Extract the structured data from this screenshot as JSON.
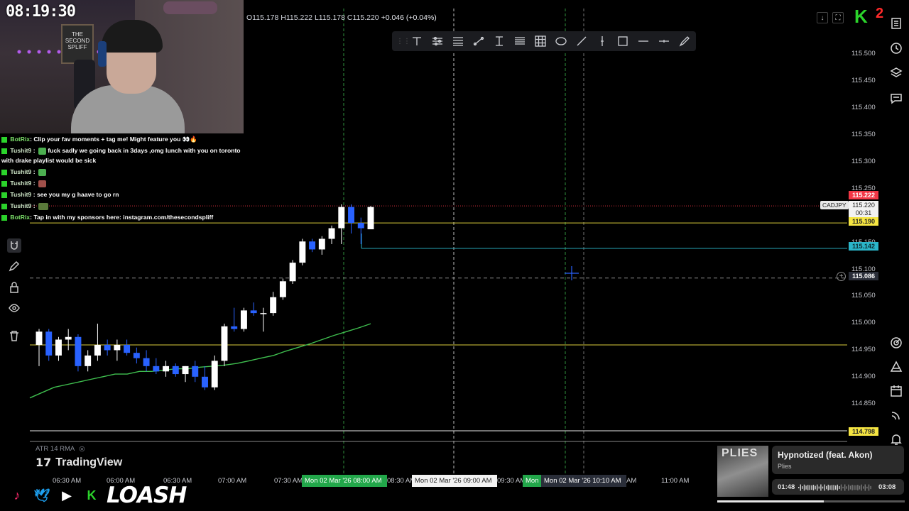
{
  "stream": {
    "clock": "08:19:30",
    "poster_text": "THE SECOND SPLIFF",
    "sign_text": "",
    "kick_count": "2",
    "streamer_name": "LOASH"
  },
  "chat": [
    {
      "user": "BotRix",
      "bot": true,
      "text": "Clip your fav moments + tag me! Might feature you 👀🔥"
    },
    {
      "user": "Tushit9",
      "bot": false,
      "text": "fuck sadly we going back in 3days ,omg lunch with you on toronto with drake playlist would be sick"
    },
    {
      "user": "Tushit9",
      "bot": false,
      "text": ""
    },
    {
      "user": "Tushit9",
      "bot": false,
      "text": ""
    },
    {
      "user": "Tushit9",
      "bot": false,
      "text": "see you my g haave to go rn"
    },
    {
      "user": "Tushit9",
      "bot": false,
      "text": ""
    },
    {
      "user": "BotRix",
      "bot": true,
      "text": "Tap in with my sponsors here: instagram.com/thesecondspliff"
    }
  ],
  "header": {
    "open": "O115.178",
    "high": "H115.222",
    "low": "L115.178",
    "close": "C115.220",
    "change": "+0.046 (+0.04%)"
  },
  "drawing_tools": [
    "text-tool",
    "filters-tool",
    "levels-tool",
    "line-tool",
    "text-cursor-tool",
    "list-tool",
    "grid-tool",
    "shape-tool",
    "diagonal-line-tool",
    "vertical-line-tool",
    "rectangle-tool",
    "horizontal-line-tool",
    "horizontal-ray-tool",
    "brush-tool"
  ],
  "price_axis": {
    "labels": [
      "115.500",
      "115.450",
      "115.400",
      "115.350",
      "115.300",
      "115.250",
      "115.150",
      "115.100",
      "115.050",
      "115.000",
      "114.950",
      "114.900",
      "114.850"
    ],
    "tags": {
      "high": "115.222",
      "current": "115.220",
      "countdown": "00:31",
      "yellow_line": "115.190",
      "cyan_line": "115.142",
      "crosshair": "115.086",
      "bottom": "114.798"
    },
    "symbol": "CADJPY",
    "colors": {
      "red": "#f23645",
      "yellow": "#f5e542",
      "cyan": "#2bb5c9",
      "green_ma": "#3fbf4f",
      "up_candle": "#ffffff",
      "down_candle": "#2962ff"
    }
  },
  "time_axis": {
    "labels": [
      "06:30 AM",
      "06:00 AM",
      "06:30 AM",
      "07:00 AM",
      "07:30 AM",
      "08:30 AM",
      "09:30 AM",
      "11:00 AM"
    ],
    "highlights": [
      {
        "text": "Mon 02 Mar '26   08:00 AM",
        "style": "green"
      },
      {
        "text": "Mon 02 Mar '26   09:00 AM",
        "style": "white"
      },
      {
        "text": "Mon",
        "style": "green"
      },
      {
        "text": "Mon 02 Mar '26   10:10 AM",
        "style": "dark"
      }
    ],
    "trailing": "AM"
  },
  "indicator": {
    "atr_label": "ATR 14 RMA",
    "logo_text": "TradingView"
  },
  "music": {
    "title": "Hypnotized (feat. Akon)",
    "artist": "Plies",
    "elapsed": "01:48",
    "duration": "03:08",
    "progress": 0.57,
    "art_text": "PLIES"
  },
  "chart_data": {
    "type": "candlestick",
    "symbol": "CADJPY",
    "ylim": [
      114.79,
      115.53
    ],
    "candles": [
      {
        "o": 114.96,
        "h": 114.99,
        "l": 114.92,
        "c": 114.985
      },
      {
        "o": 114.985,
        "h": 114.99,
        "l": 114.93,
        "c": 114.94
      },
      {
        "o": 114.94,
        "h": 114.975,
        "l": 114.93,
        "c": 114.97
      },
      {
        "o": 114.97,
        "h": 114.99,
        "l": 114.95,
        "c": 114.975
      },
      {
        "o": 114.975,
        "h": 114.98,
        "l": 114.91,
        "c": 114.92
      },
      {
        "o": 114.92,
        "h": 114.95,
        "l": 114.91,
        "c": 114.94
      },
      {
        "o": 114.94,
        "h": 115.0,
        "l": 114.93,
        "c": 114.96
      },
      {
        "o": 114.96,
        "h": 114.97,
        "l": 114.94,
        "c": 114.95
      },
      {
        "o": 114.95,
        "h": 114.97,
        "l": 114.93,
        "c": 114.96
      },
      {
        "o": 114.96,
        "h": 114.97,
        "l": 114.94,
        "c": 114.945
      },
      {
        "o": 114.945,
        "h": 114.955,
        "l": 114.925,
        "c": 114.935
      },
      {
        "o": 114.935,
        "h": 114.95,
        "l": 114.91,
        "c": 114.92
      },
      {
        "o": 114.92,
        "h": 114.935,
        "l": 114.905,
        "c": 114.91
      },
      {
        "o": 114.91,
        "h": 114.93,
        "l": 114.9,
        "c": 114.92
      },
      {
        "o": 114.92,
        "h": 114.925,
        "l": 114.9,
        "c": 114.905
      },
      {
        "o": 114.905,
        "h": 114.92,
        "l": 114.89,
        "c": 114.92
      },
      {
        "o": 114.92,
        "h": 114.93,
        "l": 114.89,
        "c": 114.9
      },
      {
        "o": 114.9,
        "h": 114.92,
        "l": 114.875,
        "c": 114.88
      },
      {
        "o": 114.88,
        "h": 114.94,
        "l": 114.875,
        "c": 114.93
      },
      {
        "o": 114.93,
        "h": 115.0,
        "l": 114.92,
        "c": 114.995
      },
      {
        "o": 114.995,
        "h": 115.03,
        "l": 114.985,
        "c": 114.99
      },
      {
        "o": 114.99,
        "h": 115.03,
        "l": 114.985,
        "c": 115.025
      },
      {
        "o": 115.025,
        "h": 115.04,
        "l": 115.015,
        "c": 115.02
      },
      {
        "o": 115.02,
        "h": 115.03,
        "l": 114.985,
        "c": 115.02
      },
      {
        "o": 115.02,
        "h": 115.06,
        "l": 115.015,
        "c": 115.05
      },
      {
        "o": 115.05,
        "h": 115.085,
        "l": 115.045,
        "c": 115.08
      },
      {
        "o": 115.08,
        "h": 115.12,
        "l": 115.075,
        "c": 115.115
      },
      {
        "o": 115.115,
        "h": 115.16,
        "l": 115.11,
        "c": 115.155
      },
      {
        "o": 115.155,
        "h": 115.16,
        "l": 115.135,
        "c": 115.14
      },
      {
        "o": 115.14,
        "h": 115.165,
        "l": 115.13,
        "c": 115.16
      },
      {
        "o": 115.16,
        "h": 115.185,
        "l": 115.15,
        "c": 115.18
      },
      {
        "o": 115.18,
        "h": 115.225,
        "l": 115.15,
        "c": 115.22
      },
      {
        "o": 115.22,
        "h": 115.225,
        "l": 115.17,
        "c": 115.19
      },
      {
        "o": 115.19,
        "h": 115.2,
        "l": 115.15,
        "c": 115.18
      },
      {
        "o": 115.178,
        "h": 115.222,
        "l": 115.178,
        "c": 115.22
      }
    ],
    "moving_average": [
      114.86,
      114.87,
      114.88,
      114.885,
      114.89,
      114.895,
      114.9,
      114.905,
      114.905,
      114.91,
      114.91,
      114.912,
      114.915,
      114.915,
      114.918,
      114.92,
      114.922,
      114.925,
      114.93,
      114.935,
      114.94,
      114.948,
      114.955,
      114.962,
      114.97,
      114.978,
      114.985,
      114.992,
      115.0
    ],
    "horizontal_levels": [
      {
        "value": 115.222,
        "color": "red"
      },
      {
        "value": 115.19,
        "color": "yellow"
      },
      {
        "value": 115.142,
        "color": "cyan"
      },
      {
        "value": 114.96,
        "color": "yellow"
      },
      {
        "value": 114.798,
        "color": "white"
      }
    ]
  }
}
